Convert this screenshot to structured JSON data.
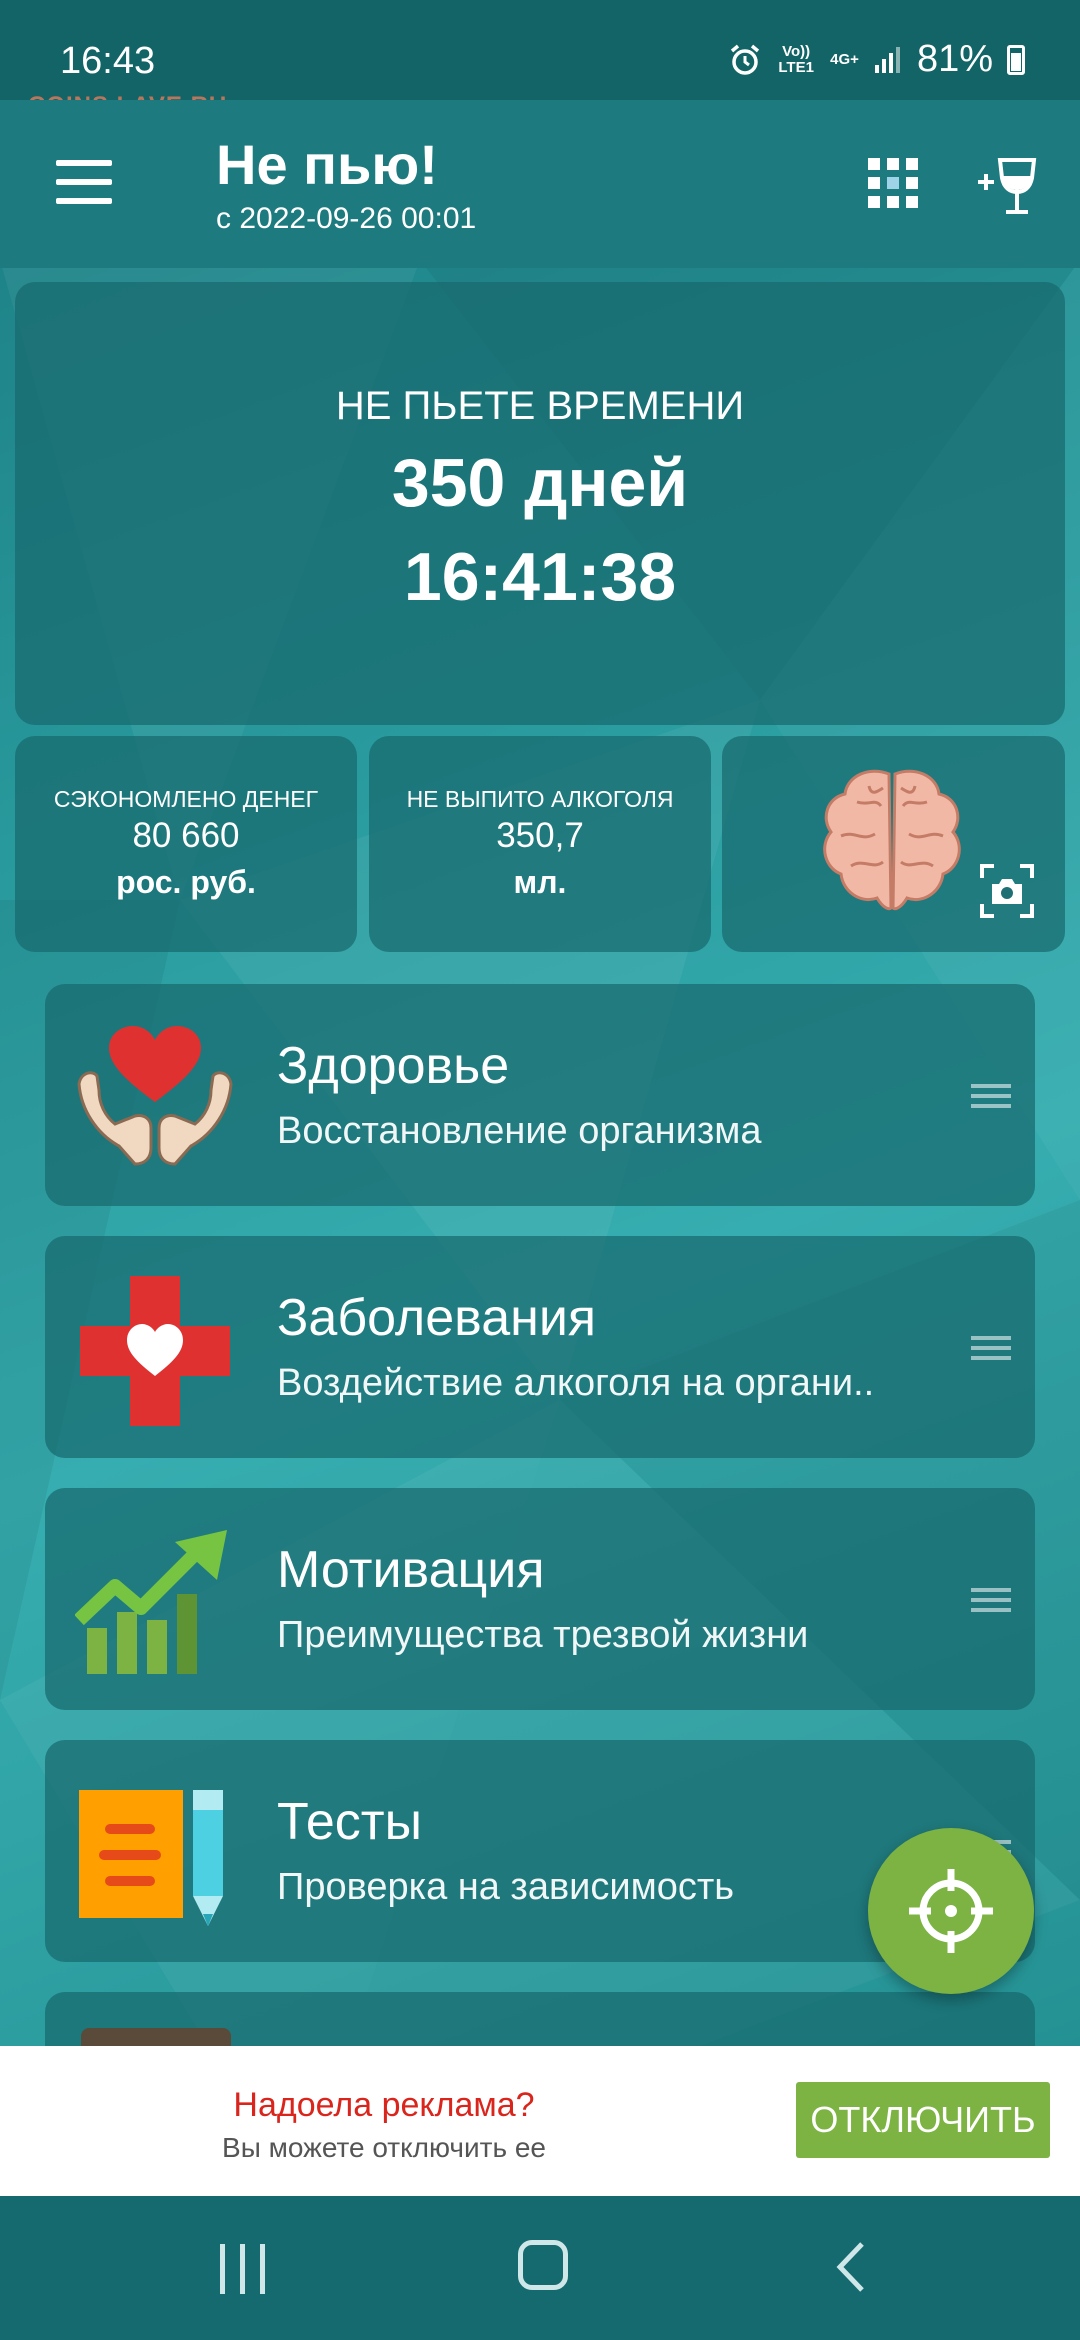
{
  "status_bar": {
    "time": "16:43",
    "network_top": "Vo)) LTE1",
    "network_type": "4G+",
    "battery": "81%"
  },
  "watermark": "COINS.LAVE.RU",
  "app_bar": {
    "title": "Не пью!",
    "subtitle": "с 2022-09-26 00:01",
    "menu_icon": "hamburger-menu-icon",
    "grid_icon": "grid-icon",
    "drink_icon": "add-drink-icon"
  },
  "timer": {
    "label": "НЕ ПЬЕТЕ ВРЕМЕНИ",
    "days": "350 дней",
    "clock": "16:41:38"
  },
  "stats": [
    {
      "label": "СЭКОНОМЛЕНО ДЕНЕГ",
      "value": "80 660",
      "unit": "рос. руб."
    },
    {
      "label": "НЕ ВЫПИТО АЛКОГОЛЯ",
      "value": "350,7",
      "unit": "мл."
    }
  ],
  "brain_icon": "brain-icon",
  "camera_icon": "screenshot-camera-icon",
  "cards": [
    {
      "title": "Здоровье",
      "subtitle": "Восстановление организма",
      "icon": "heart-hands-icon"
    },
    {
      "title": "Заболевания",
      "subtitle": "Воздействие алкоголя на органи..",
      "icon": "medical-cross-heart-icon"
    },
    {
      "title": "Мотивация",
      "subtitle": "Преимущества трезвой жизни",
      "icon": "growth-chart-icon"
    },
    {
      "title": "Тесты",
      "subtitle": "Проверка на зависимость",
      "icon": "notepad-pencil-icon"
    }
  ],
  "fab_icon": "crosshair-target-icon",
  "ad": {
    "title": "Надоела реклама?",
    "subtitle": "Вы можете отключить ее",
    "button": "ОТКЛЮЧИТЬ"
  },
  "nav": {
    "recent_icon": "recent-apps-icon",
    "home_icon": "home-icon",
    "back_icon": "back-icon"
  },
  "colors": {
    "status_bar": "#126466",
    "app_bar": "#1d7b7f",
    "panel": "#18696e",
    "accent_green": "#7cb342",
    "ad_title_red": "#d9251c"
  }
}
